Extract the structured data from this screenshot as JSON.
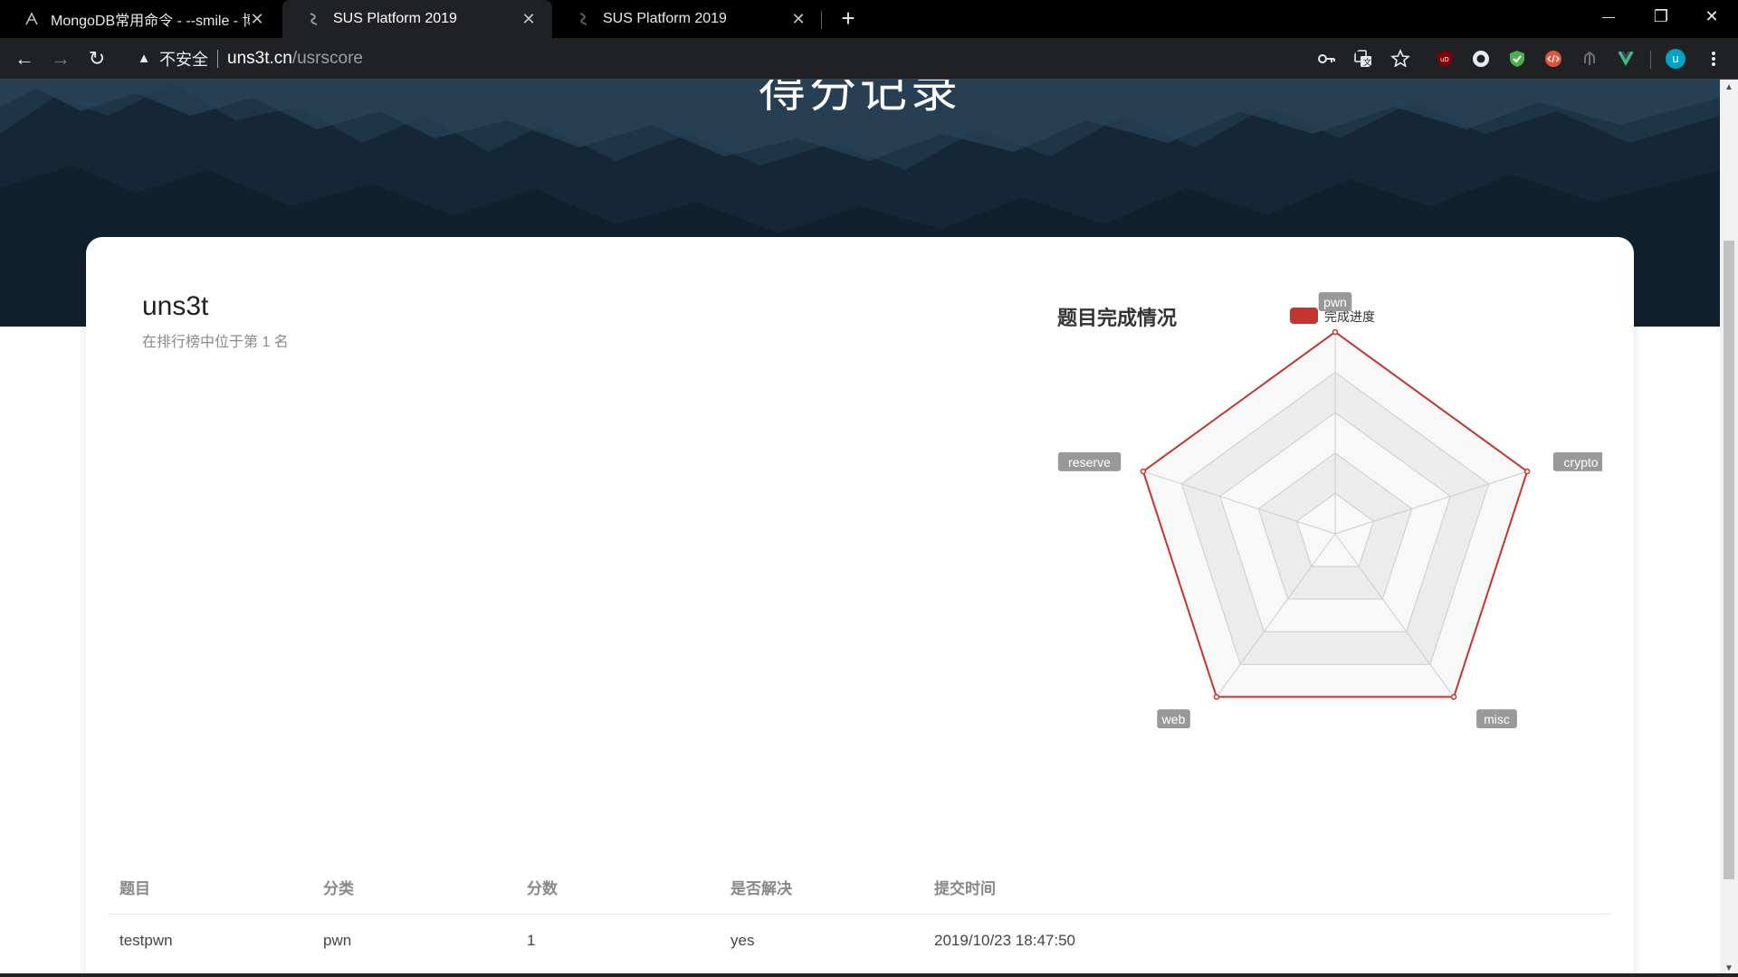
{
  "browser": {
    "tabs": [
      {
        "title": "MongoDB常用命令 - --smile - 博客园",
        "active": false,
        "icon": "cnblogs-favicon"
      },
      {
        "title": "SUS Platform 2019",
        "active": true,
        "icon": "sus-favicon"
      },
      {
        "title": "SUS Platform 2019",
        "active": false,
        "icon": "sus-favicon"
      }
    ],
    "close_glyph": "✕",
    "new_tab_glyph": "+",
    "window_controls": {
      "minimize": "—",
      "restore": "❐",
      "close": "✕"
    },
    "nav": {
      "back": "←",
      "forward": "→",
      "reload": "↻"
    },
    "omnibox": {
      "security_icon": "warning-icon",
      "insecure_label": "不安全",
      "host": "uns3t.cn",
      "path": "/usrscore"
    },
    "extensions": [
      {
        "name": "key-icon",
        "color": "#e8eaed"
      },
      {
        "name": "translate-icon",
        "color": "#e8eaed"
      },
      {
        "name": "star-icon",
        "color": "#e8eaed"
      },
      {
        "name": "ublock-icon",
        "color": "#800000"
      },
      {
        "name": "circle-extension-icon",
        "color": "#e8eaed"
      },
      {
        "name": "shield-extension-icon",
        "color": "#4caf50"
      },
      {
        "name": "code-extension-icon",
        "color": "#e0533c"
      },
      {
        "name": "trident-extension-icon",
        "color": "#6f6f6f"
      },
      {
        "name": "vue-extension-icon",
        "color": "#42b883"
      },
      {
        "name": "profile-avatar",
        "color": "#00a3c4",
        "letter": "u"
      },
      {
        "name": "menu-icon",
        "color": "#e8eaed"
      }
    ]
  },
  "page": {
    "hero_title": "得分记录",
    "user": {
      "name": "uns3t",
      "rank_text": "在排行榜中位于第 1 名"
    },
    "table": {
      "headers": [
        "题目",
        "分类",
        "分数",
        "是否解决",
        "提交时间"
      ],
      "rows": [
        [
          "testpwn",
          "pwn",
          "1",
          "yes",
          "2019/10/23 18:47:50"
        ]
      ]
    }
  },
  "chart_data": {
    "type": "radar",
    "title": "题目完成情况",
    "indicators": [
      "pwn",
      "crypto",
      "misc",
      "web",
      "reserve"
    ],
    "series": [
      {
        "name": "完成进度",
        "color": "#c23531",
        "values": [
          1,
          1,
          1,
          1,
          1
        ]
      }
    ],
    "max": 1,
    "split_number": 5,
    "legend_position": "top"
  }
}
